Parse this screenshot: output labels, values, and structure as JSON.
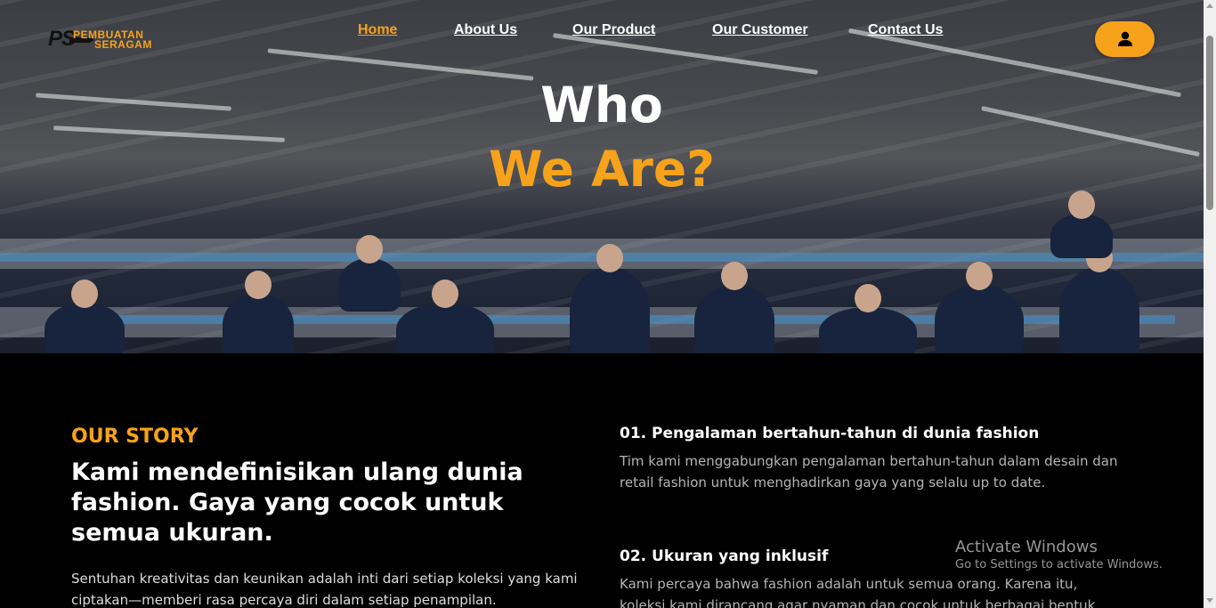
{
  "logo": {
    "mark": "PS",
    "line1": "PEMBUATAN",
    "line2": "SERAGAM"
  },
  "nav": {
    "items": [
      {
        "label": "Home",
        "active": true
      },
      {
        "label": "About Us",
        "active": false
      },
      {
        "label": "Our Product",
        "active": false
      },
      {
        "label": "Our Customer",
        "active": false
      },
      {
        "label": "Contact Us",
        "active": false
      }
    ],
    "user_button_icon": "user-icon"
  },
  "hero": {
    "line1": "Who",
    "line2": "We Are?"
  },
  "story": {
    "kicker": "OUR STORY",
    "headline": "Kami mendefinisikan ulang dunia fashion. Gaya yang cocok untuk semua ukuran.",
    "body": "Sentuhan kreativitas dan keunikan adalah inti dari setiap koleksi yang kami ciptakan—memberi rasa percaya diri dalam setiap penampilan."
  },
  "features": [
    {
      "title": "01. Pengalaman bertahun-tahun di dunia fashion",
      "body": "Tim kami menggabungkan pengalaman bertahun-tahun dalam desain dan retail fashion untuk menghadirkan gaya yang selalu up to date."
    },
    {
      "title": "02. Ukuran yang inklusif",
      "body": "Kami percaya bahwa fashion adalah untuk semua orang. Karena itu, koleksi kami dirancang agar nyaman dan cocok untuk berbagai bentuk"
    }
  ],
  "watermark": {
    "line1": "Activate Windows",
    "line2": "Go to Settings to activate Windows."
  },
  "colors": {
    "accent": "#f7a21b",
    "background": "#000000"
  }
}
